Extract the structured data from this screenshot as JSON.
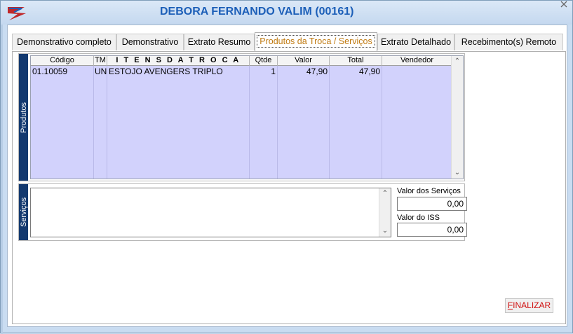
{
  "window": {
    "title": "DEBORA FERNANDO VALIM (00161)"
  },
  "tabs": [
    {
      "label": "Demonstrativo completo",
      "active": false
    },
    {
      "label": "Demonstrativo",
      "active": false
    },
    {
      "label": "Extrato Resumo",
      "active": false
    },
    {
      "label": "Produtos da Troca / Serviços",
      "active": true
    },
    {
      "label": "Extrato Detalhado",
      "active": false
    },
    {
      "label": "Recebimento(s) Remoto",
      "active": false
    }
  ],
  "produtos": {
    "group_label": "Produtos",
    "columns": [
      "Código",
      "TM",
      "I T E N S  D A  T R O C A",
      "Qtde",
      "Valor",
      "Total",
      "Vendedor"
    ],
    "rows": [
      {
        "codigo": "01.10059",
        "tm": "UN",
        "item": "ESTOJO AVENGERS TRIPLO",
        "qtde": "1",
        "valor": "47,90",
        "total": "47,90",
        "vendedor": ""
      }
    ]
  },
  "servicos": {
    "group_label": "Serviços",
    "memo_text": "",
    "valor_servicos_label": "Valor dos Serviços",
    "valor_servicos": "0,00",
    "valor_iss_label": "Valor do ISS",
    "valor_iss": "0,00"
  },
  "actions": {
    "finalizar_first": "F",
    "finalizar_rest": "INALIZAR"
  },
  "colors": {
    "title": "#1c5fb8",
    "grid_bg": "#d2d2fc",
    "group_label_bg": "#13396f",
    "finalizar_text": "#d01010",
    "active_tab_text": "#c07a10"
  }
}
